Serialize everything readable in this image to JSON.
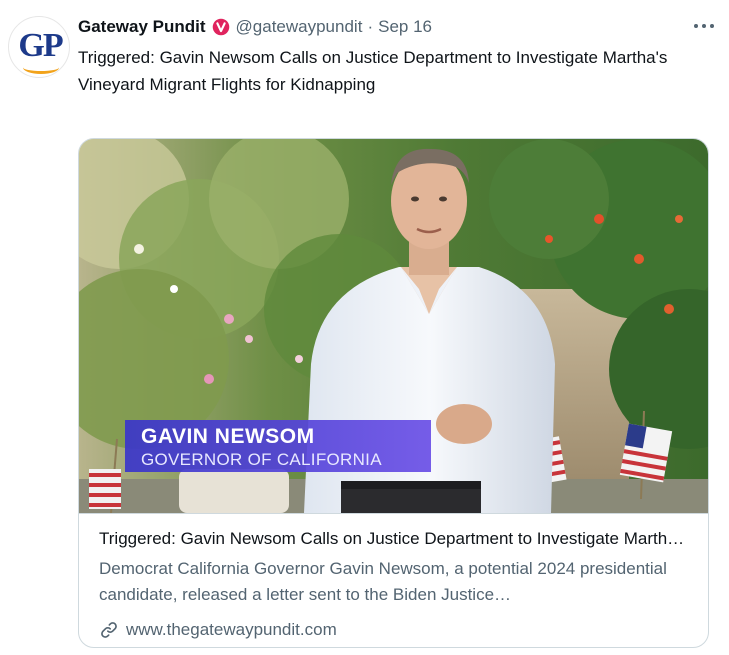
{
  "tweet": {
    "author_name": "Gateway Pundit",
    "handle": "@gatewaypundit",
    "separator": "·",
    "date": "Sep 16",
    "avatar_text": "GP",
    "text": "Triggered: Gavin Newsom Calls on Justice Department to Investigate Martha's Vineyard Migrant Flights for Kidnapping"
  },
  "card": {
    "image_caption_name": "GAVIN NEWSOM",
    "image_caption_title": "GOVERNOR OF CALIFORNIA",
    "title": "Triggered: Gavin Newsom Calls on Justice Department to Investigate Martha's Vineyard Migrant Flights for Kidnapping",
    "description": "Democrat California Governor Gavin Newsom, a potential 2024 presidential candidate, released a letter sent to the Biden Justice…",
    "domain": "www.thegatewaypundit.com"
  },
  "icons": {
    "verified": "verified-badge-icon",
    "more": "more-options-icon",
    "link": "link-icon"
  },
  "colors": {
    "verified": "#e0245e",
    "secondary_text": "#536471",
    "lower_third": "#4a3fd6",
    "avatar_text": "#1d3a8a",
    "avatar_accent": "#f2a31b"
  }
}
